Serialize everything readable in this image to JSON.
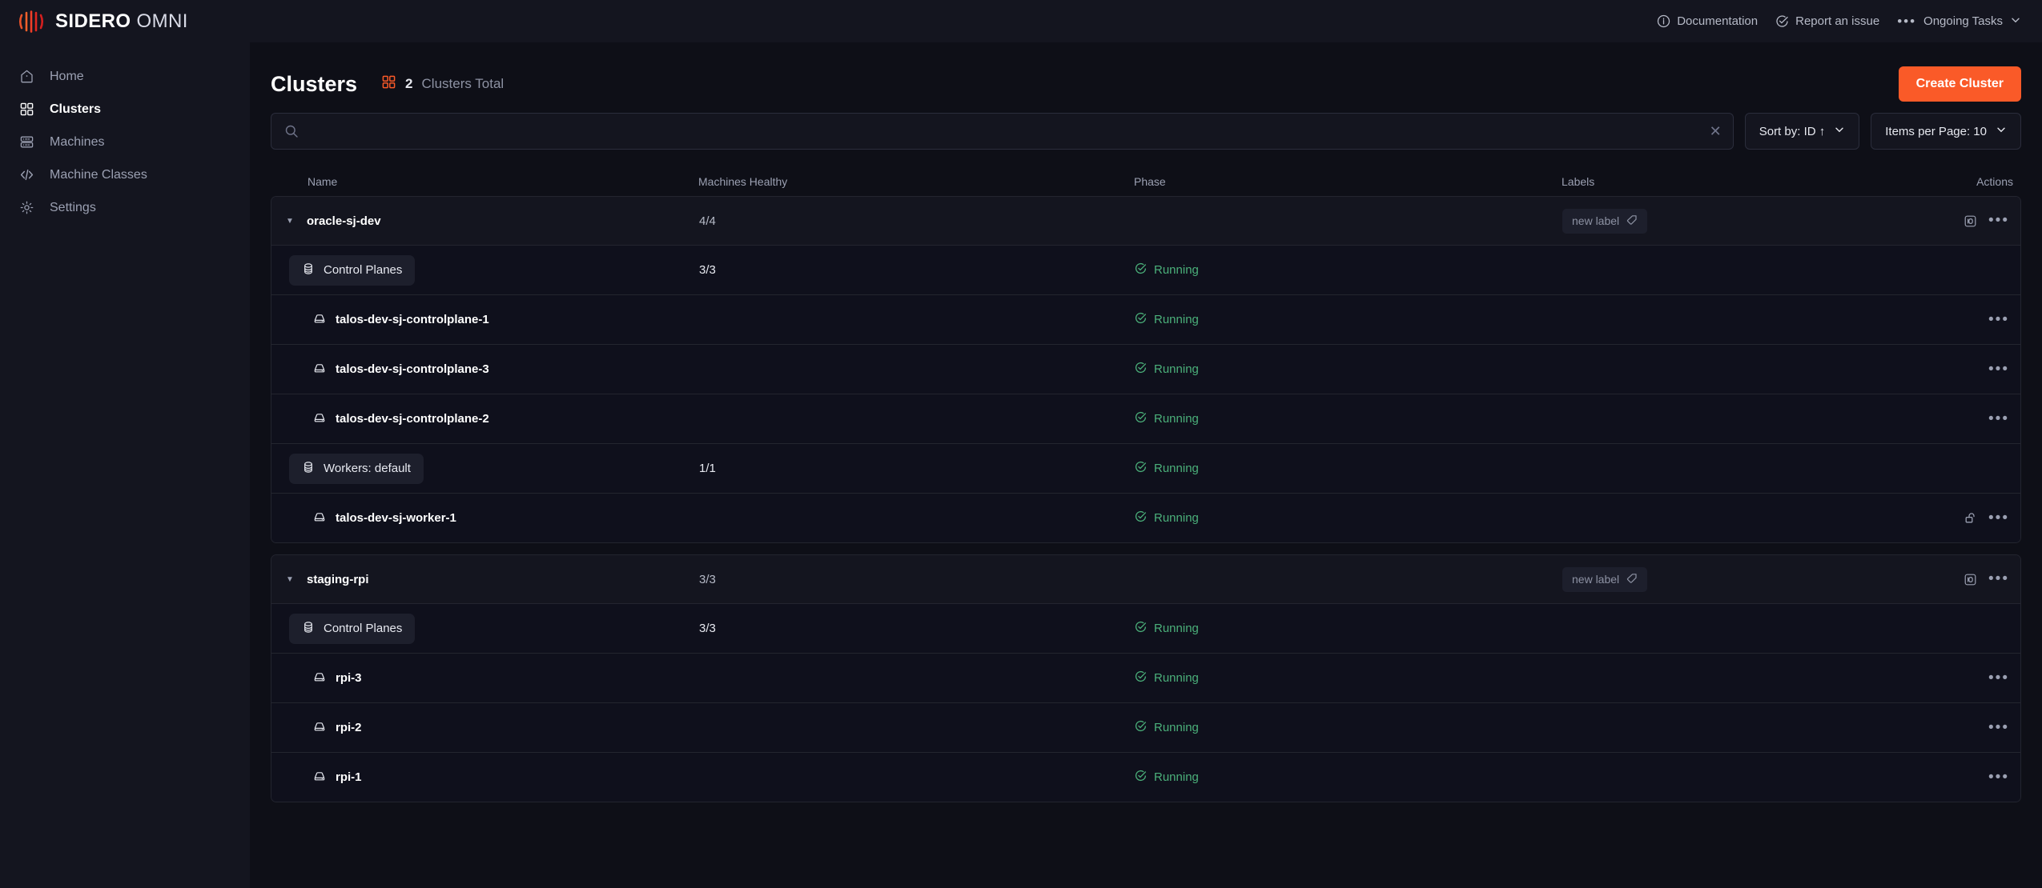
{
  "brand": {
    "name": "SIDERO",
    "product": "OMNI",
    "logo_icon": "sidero-logo-icon"
  },
  "topbar": {
    "documentation": "Documentation",
    "report_issue": "Report an issue",
    "ongoing_tasks": "Ongoing Tasks",
    "info_icon": "info-circle-icon",
    "report_icon": "check-circle-icon",
    "tasks_icon": "ellipsis-icon",
    "chevron_icon": "chevron-down-icon"
  },
  "sidebar": {
    "items": [
      {
        "label": "Home",
        "icon": "home-icon",
        "active": false
      },
      {
        "label": "Clusters",
        "icon": "grid-icon",
        "active": true
      },
      {
        "label": "Machines",
        "icon": "server-icon",
        "active": false
      },
      {
        "label": "Machine Classes",
        "icon": "code-icon",
        "active": false
      },
      {
        "label": "Settings",
        "icon": "gear-icon",
        "active": false
      }
    ]
  },
  "page": {
    "title": "Clusters",
    "total_count": "2",
    "total_suffix": "Clusters Total",
    "total_icon": "grid-icon",
    "create_button": "Create Cluster",
    "accent_color": "#fa5a28"
  },
  "controls": {
    "search_value": "",
    "search_placeholder": "",
    "search_icon": "search-icon",
    "clear_icon": "close-icon",
    "sort_label": "Sort by: ID ↑",
    "items_per_page_label": "Items per Page: 10"
  },
  "table": {
    "columns": [
      "Name",
      "Machines Healthy",
      "Phase",
      "Labels",
      "Actions"
    ],
    "clusters": [
      {
        "name": "oracle-sj-dev",
        "machines_healthy": "4/4",
        "phase": "",
        "label_chip": "new label",
        "label_icon": "tag-icon",
        "action_icon": "terminal-icon",
        "menu_icon": "ellipsis-icon",
        "groups": [
          {
            "name": "Control Planes",
            "icon": "server-stack-icon",
            "machines_healthy": "3/3",
            "phase": "Running",
            "machines": [
              {
                "name": "talos-dev-sj-controlplane-1",
                "phase": "Running",
                "icon": "server-icon",
                "menu_icon": "ellipsis-icon",
                "lock_icon": ""
              },
              {
                "name": "talos-dev-sj-controlplane-3",
                "phase": "Running",
                "icon": "server-icon",
                "menu_icon": "ellipsis-icon",
                "lock_icon": ""
              },
              {
                "name": "talos-dev-sj-controlplane-2",
                "phase": "Running",
                "icon": "server-icon",
                "menu_icon": "ellipsis-icon",
                "lock_icon": ""
              }
            ]
          },
          {
            "name": "Workers: default",
            "icon": "server-stack-icon",
            "machines_healthy": "1/1",
            "phase": "Running",
            "machines": [
              {
                "name": "talos-dev-sj-worker-1",
                "phase": "Running",
                "icon": "server-icon",
                "menu_icon": "ellipsis-icon",
                "lock_icon": "unlock-icon"
              }
            ]
          }
        ]
      },
      {
        "name": "staging-rpi",
        "machines_healthy": "3/3",
        "phase": "",
        "label_chip": "new label",
        "label_icon": "tag-icon",
        "action_icon": "terminal-icon",
        "menu_icon": "ellipsis-icon",
        "groups": [
          {
            "name": "Control Planes",
            "icon": "server-stack-icon",
            "machines_healthy": "3/3",
            "phase": "Running",
            "machines": [
              {
                "name": "rpi-3",
                "phase": "Running",
                "icon": "server-icon",
                "menu_icon": "ellipsis-icon",
                "lock_icon": ""
              },
              {
                "name": "rpi-2",
                "phase": "Running",
                "icon": "server-icon",
                "menu_icon": "ellipsis-icon",
                "lock_icon": ""
              },
              {
                "name": "rpi-1",
                "phase": "Running",
                "icon": "server-icon",
                "menu_icon": "ellipsis-icon",
                "lock_icon": ""
              }
            ]
          }
        ]
      }
    ]
  },
  "status_colors": {
    "running": "#4bb07a"
  }
}
